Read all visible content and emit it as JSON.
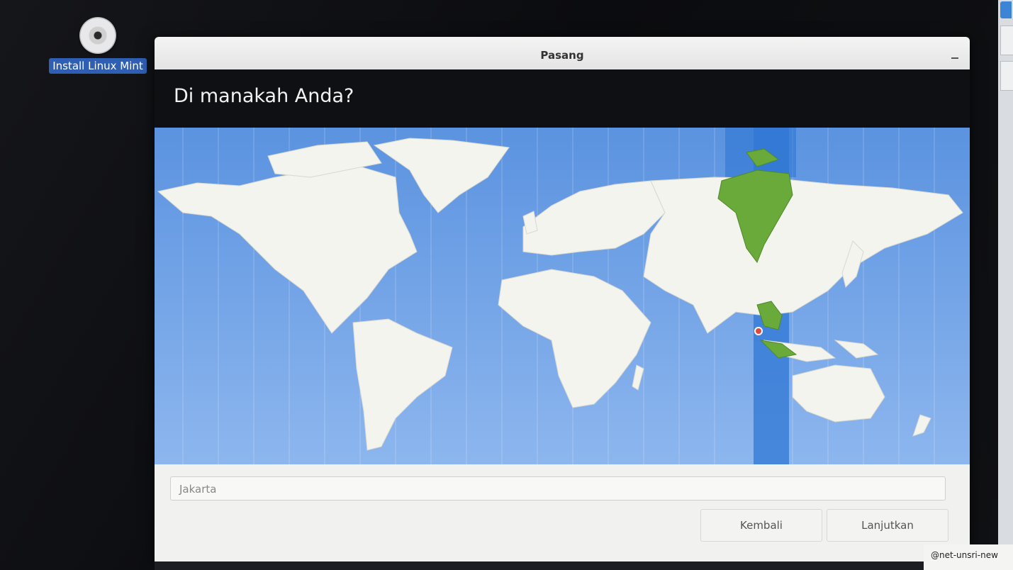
{
  "desktop": {
    "icon_label": "Install Linux Mint",
    "icon_name": "disc-icon"
  },
  "window": {
    "title": "Pasang",
    "heading": "Di manakah Anda?"
  },
  "map": {
    "selected_city": "Jakarta",
    "highlight_color": "#6aaa3a",
    "timezone_band_color": "#2f77d4",
    "land_color": "#f4f4ef",
    "ocean_color": "#7aa8e8",
    "marker_color": "#e0483f"
  },
  "location": {
    "value": "Jakarta"
  },
  "buttons": {
    "back": "Kembali",
    "next": "Lanjutkan"
  },
  "notification": {
    "text": "@net-unsri-new"
  }
}
